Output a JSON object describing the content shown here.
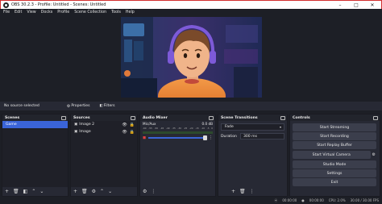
{
  "window": {
    "title": "OBS 30.2.3 - Profile: Untitled - Scenes: Untitled",
    "minimize": "–",
    "maximize": "□",
    "close": "✕"
  },
  "menu": [
    "File",
    "Edit",
    "View",
    "Docks",
    "Profile",
    "Scene Collection",
    "Tools",
    "Help"
  ],
  "infobar": {
    "no_source": "No source selected",
    "properties": "Properties",
    "filters": "Filters"
  },
  "scenes": {
    "title": "Scenes",
    "items": [
      "Game"
    ]
  },
  "sources": {
    "title": "Sources",
    "items": [
      "Image 2",
      "Image"
    ]
  },
  "mixer": {
    "title": "Audio Mixer",
    "channel": "Mic/Aux",
    "level": "0.0 dB",
    "ticks": [
      "-60",
      "-55",
      "-50",
      "-45",
      "-40",
      "-35",
      "-30",
      "-25",
      "-20",
      "-15",
      "-10",
      "-5",
      "0"
    ]
  },
  "transitions": {
    "title": "Scene Transitions",
    "type": "Fade",
    "duration_label": "Duration",
    "duration_value": "300 ms"
  },
  "controls": {
    "title": "Controls",
    "buttons": [
      "Start Streaming",
      "Start Recording",
      "Start Replay Buffer",
      "Start Virtual Camera",
      "Studio Mode",
      "Settings",
      "Exit"
    ]
  },
  "status": {
    "streaming_time": "00:00:00",
    "recording_time": "00:00:00",
    "cpu": "CPU: 2.0%",
    "fps": "30.00 / 30.00 FPS"
  }
}
